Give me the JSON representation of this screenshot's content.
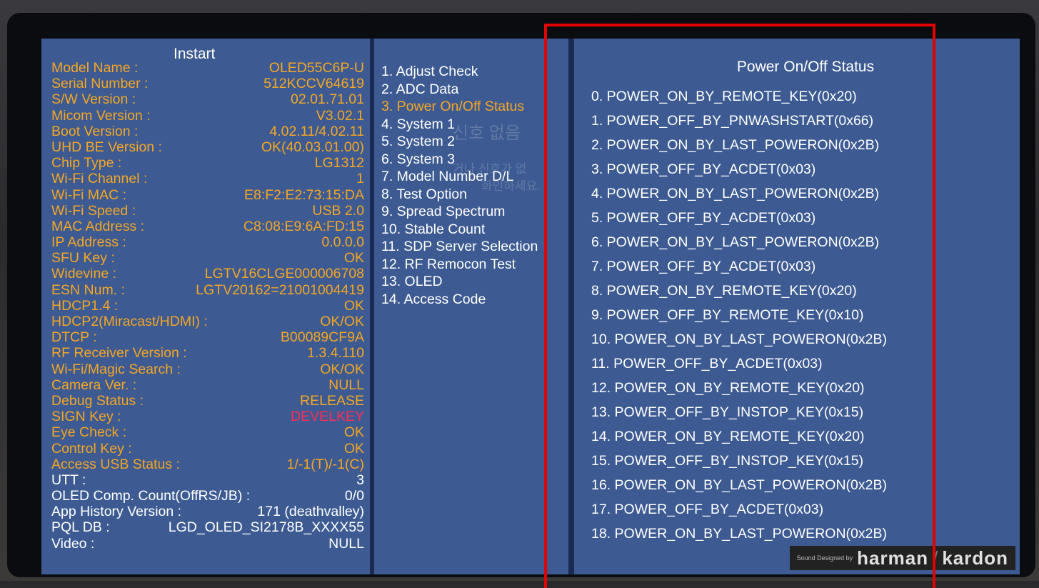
{
  "left": {
    "title": "Instart",
    "rows": [
      {
        "label": "Model Name :",
        "value": "OLED55C6P-U"
      },
      {
        "label": "Serial Number :",
        "value": "512KCCV64619"
      },
      {
        "label": "S/W Version :",
        "value": "02.01.71.01"
      },
      {
        "label": "Micom Version :",
        "value": "V3.02.1"
      },
      {
        "label": "Boot Version :",
        "value": "4.02.11/4.02.11"
      },
      {
        "label": "UHD BE Version :",
        "value": "OK(40.03.01.00)"
      },
      {
        "label": "Chip Type :",
        "value": "LG1312"
      },
      {
        "label": "Wi-Fi Channel :",
        "value": "1"
      },
      {
        "label": "Wi-Fi MAC :",
        "value": "E8:F2:E2:73:15:DA"
      },
      {
        "label": "Wi-Fi Speed :",
        "value": "USB 2.0"
      },
      {
        "label": "MAC Address :",
        "value": "C8:08:E9:6A:FD:15"
      },
      {
        "label": "IP Address :",
        "value": "0.0.0.0"
      },
      {
        "label": "SFU Key :",
        "value": "OK"
      },
      {
        "label": "Widevine :",
        "value": "LGTV16CLGE000006708"
      },
      {
        "label": "ESN Num. :",
        "value": "LGTV20162=21001004419"
      },
      {
        "label": "HDCP1.4 :",
        "value": "OK"
      },
      {
        "label": "HDCP2(Miracast/HDMI) :",
        "value": "OK/OK"
      },
      {
        "label": "DTCP :",
        "value": "B00089CF9A"
      },
      {
        "label": "RF Receiver Version :",
        "value": "1.3.4.110"
      },
      {
        "label": "Wi-Fi/Magic Search :",
        "value": "OK/OK"
      },
      {
        "label": "Camera Ver. :",
        "value": "NULL"
      },
      {
        "label": "Debug Status :",
        "value": "RELEASE"
      },
      {
        "label": "SIGN Key :",
        "value": "DEVELKEY"
      },
      {
        "label": "Eye Check :",
        "value": "OK"
      },
      {
        "label": "Control Key :",
        "value": "OK"
      },
      {
        "label": "Access USB Status :",
        "value": "1/-1(T)/-1(C)"
      },
      {
        "label": "UTT :",
        "value": "3"
      },
      {
        "label": "OLED Comp. Count(OffRS/JB) :",
        "value": "0/0"
      },
      {
        "label": "App History Version :",
        "value": "171 (deathvalley)"
      },
      {
        "label": "PQL DB :",
        "value": "LGD_OLED_SI2178B_XXXX55"
      },
      {
        "label": "Video :",
        "value": "NULL"
      }
    ]
  },
  "menu": {
    "items": [
      "1. Adjust Check",
      "2. ADC Data",
      "3. Power On/Off Status",
      "4. System 1",
      "5. System 2",
      "6. System 3",
      "7. Model Number D/L",
      "8. Test Option",
      "9. Spread Spectrum",
      "10. Stable Count",
      "11. SDP Server Selection",
      "12. RF Remocon Test",
      "13. OLED",
      "14. Access Code"
    ],
    "active_index": 2
  },
  "background_osd": {
    "line1": "신호 없음",
    "line2": "거나 신호가 없",
    "line3": "화인하세요."
  },
  "status": {
    "title": "Power On/Off Status",
    "items": [
      "0. POWER_ON_BY_REMOTE_KEY(0x20)",
      "1. POWER_OFF_BY_PNWASHSTART(0x66)",
      "2. POWER_ON_BY_LAST_POWERON(0x2B)",
      "3. POWER_OFF_BY_ACDET(0x03)",
      "4. POWER_ON_BY_LAST_POWERON(0x2B)",
      "5. POWER_OFF_BY_ACDET(0x03)",
      "6. POWER_ON_BY_LAST_POWERON(0x2B)",
      "7. POWER_OFF_BY_ACDET(0x03)",
      "8. POWER_ON_BY_REMOTE_KEY(0x20)",
      "9. POWER_OFF_BY_REMOTE_KEY(0x10)",
      "10. POWER_ON_BY_LAST_POWERON(0x2B)",
      "11. POWER_OFF_BY_ACDET(0x03)",
      "12. POWER_ON_BY_REMOTE_KEY(0x20)",
      "13. POWER_OFF_BY_INSTOP_KEY(0x15)",
      "14. POWER_ON_BY_REMOTE_KEY(0x20)",
      "15. POWER_OFF_BY_INSTOP_KEY(0x15)",
      "16. POWER_ON_BY_LAST_POWERON(0x2B)",
      "17. POWER_OFF_BY_ACDET(0x03)",
      "18. POWER_ON_BY_LAST_POWERON(0x2B)"
    ]
  },
  "brand": {
    "prefix": "Sound Designed by",
    "name_a": "harman",
    "separator": "/",
    "name_b": "kardon"
  },
  "colors": {
    "panel": "#3d5b92",
    "label": "#f5a623",
    "text": "#ffffff",
    "alert": "#ff2d55",
    "highlight_box": "#e30000"
  }
}
